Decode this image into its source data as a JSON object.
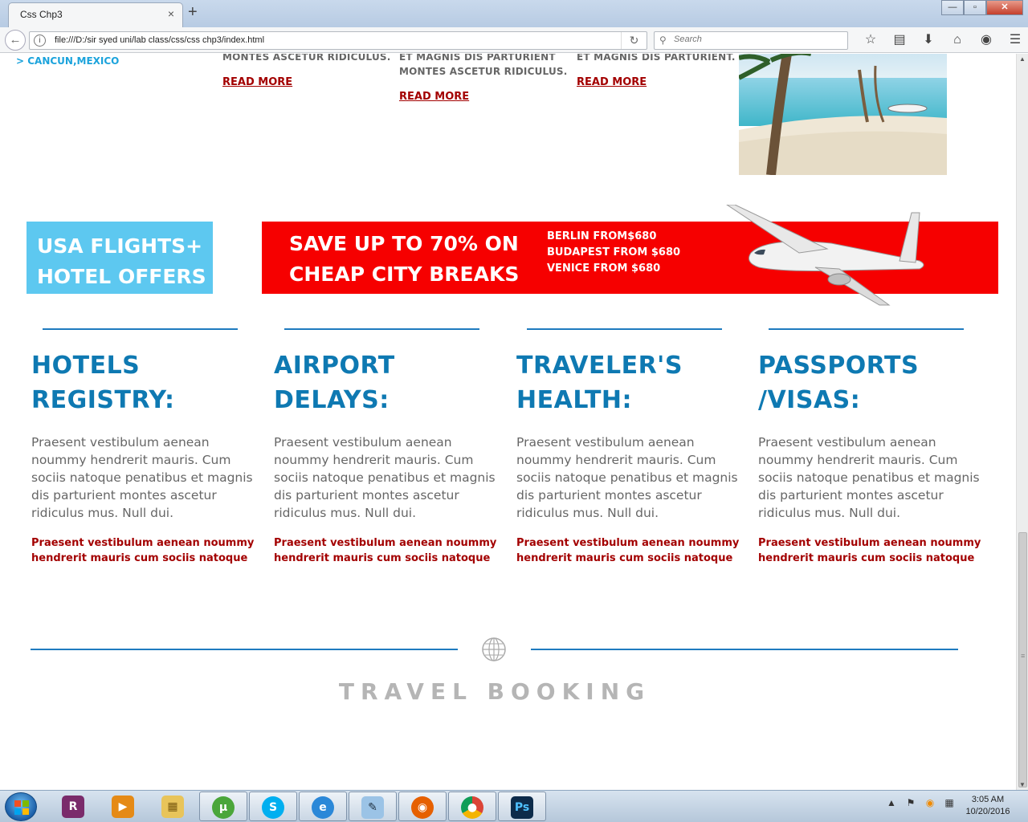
{
  "browser": {
    "tab_title": "Css Chp3",
    "tab_close": "×",
    "new_tab": "+",
    "url": "file:///D:/sir syed uni/lab class/css/css chp3/index.html",
    "search_placeholder": "Search",
    "window_buttons": {
      "minimize": "—",
      "maximize": "▫",
      "close": "✕"
    }
  },
  "top": {
    "location": "> CANCUN,MEXICO",
    "columns": [
      {
        "lines": [
          "MONTES ASCETUR RIDICULUS."
        ],
        "read_more": "READ MORE"
      },
      {
        "lines": [
          "ET MAGNIS DIS PARTURIENT",
          "MONTES ASCETUR RIDICULUS."
        ],
        "read_more": "READ MORE"
      },
      {
        "lines": [
          "ET MAGNIS DIS PARTURIENT."
        ],
        "read_more": "READ MORE"
      }
    ]
  },
  "promo": {
    "usa": [
      "USA FLIGHTS+",
      "HOTEL OFFERS"
    ],
    "save": [
      "SAVE UP TO 70% ON",
      "CHEAP CITY BREAKS"
    ],
    "cities": [
      "BERLIN FROM$680",
      "BUDAPEST FROM $680",
      "VENICE FROM $680"
    ]
  },
  "info": [
    {
      "title": [
        "HOTELS",
        "REGISTRY:"
      ],
      "body": "Praesent vestibulum aenean noummy hendrerit mauris. Cum sociis natoque penatibus et magnis dis parturient montes ascetur ridiculus mus. Null dui.",
      "link": "Praesent vestibulum aenean noummy hendrerit mauris cum sociis natoque"
    },
    {
      "title": [
        "AIRPORT",
        "DELAYS:"
      ],
      "body": "Praesent vestibulum aenean noummy hendrerit mauris. Cum sociis natoque penatibus et magnis dis parturient montes ascetur ridiculus mus. Null dui.",
      "link": "Praesent vestibulum aenean noummy hendrerit mauris cum sociis natoque"
    },
    {
      "title": [
        "TRAVELER'S",
        "HEALTH:"
      ],
      "body": "Praesent vestibulum aenean noummy hendrerit mauris. Cum sociis natoque penatibus et magnis dis parturient montes ascetur ridiculus mus. Null dui.",
      "link": "Praesent vestibulum aenean noummy hendrerit mauris cum sociis natoque"
    },
    {
      "title": [
        "PASSPORTS",
        "/VISAS:"
      ],
      "body": "Praesent vestibulum aenean noummy hendrerit mauris. Cum sociis natoque penatibus et magnis dis parturient montes ascetur ridiculus mus. Null dui.",
      "link": "Praesent vestibulum aenean noummy hendrerit mauris cum sociis natoque"
    }
  ],
  "footer": {
    "title": "TRAVEL BOOKING"
  },
  "taskbar": {
    "apps": [
      "winrar-icon",
      "media-player-icon",
      "explorer-icon",
      "utorrent-icon",
      "skype-icon",
      "internet-explorer-icon",
      "notepad-icon",
      "firefox-icon",
      "chrome-icon",
      "photoshop-icon"
    ],
    "time": "3:05 AM",
    "date": "10/20/2016"
  },
  "colors": {
    "accent_blue": "#0e79b2",
    "light_blue": "#5dc8f0",
    "promo_red": "#f60000",
    "link_red": "#a30000"
  }
}
